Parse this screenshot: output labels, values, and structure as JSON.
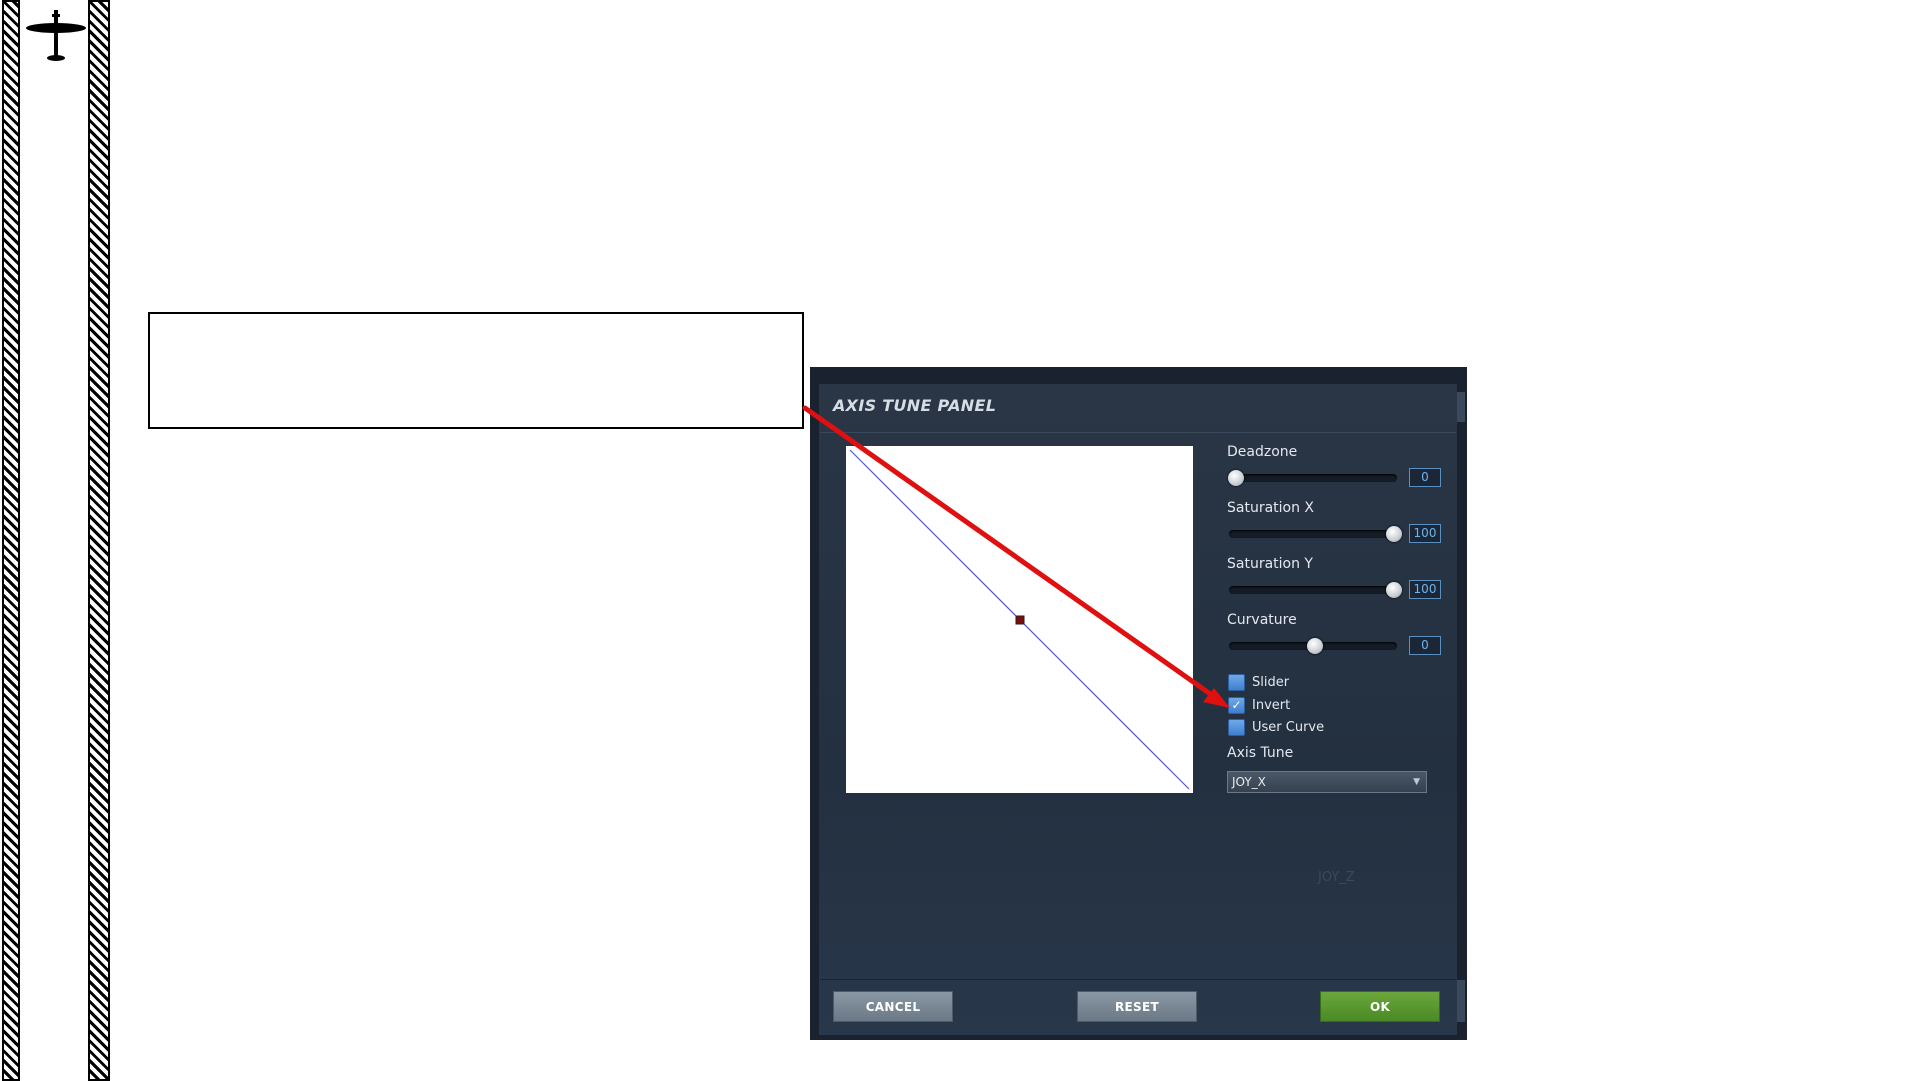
{
  "colors": {
    "panel_bg": "#233040",
    "accent_blue": "#4f8fdc",
    "ok_green": "#5a9a30",
    "annotation_red": "#e01010",
    "curve_line": "#5555cc"
  },
  "sidebar": {
    "logo_icon": "airplane-icon"
  },
  "panel": {
    "title": "AXIS TUNE PANEL",
    "controls": {
      "deadzone": {
        "label": "Deadzone",
        "value": "0",
        "level": 0
      },
      "saturation_x": {
        "label": "Saturation X",
        "value": "100",
        "level": 1
      },
      "saturation_y": {
        "label": "Saturation Y",
        "value": "100",
        "level": 1
      },
      "curvature": {
        "label": "Curvature",
        "value": "0",
        "level": 0.5
      }
    },
    "checkboxes": {
      "slider": {
        "label": "Slider",
        "checked": false
      },
      "invert": {
        "label": "Invert",
        "checked": true
      },
      "user_curve": {
        "label": "User Curve",
        "checked": false
      }
    },
    "axis_tune": {
      "label": "Axis Tune",
      "selected": "JOY_X"
    },
    "faint_label": "JOY_Z",
    "buttons": {
      "cancel": "CANCEL",
      "reset": "RESET",
      "ok": "OK"
    }
  }
}
